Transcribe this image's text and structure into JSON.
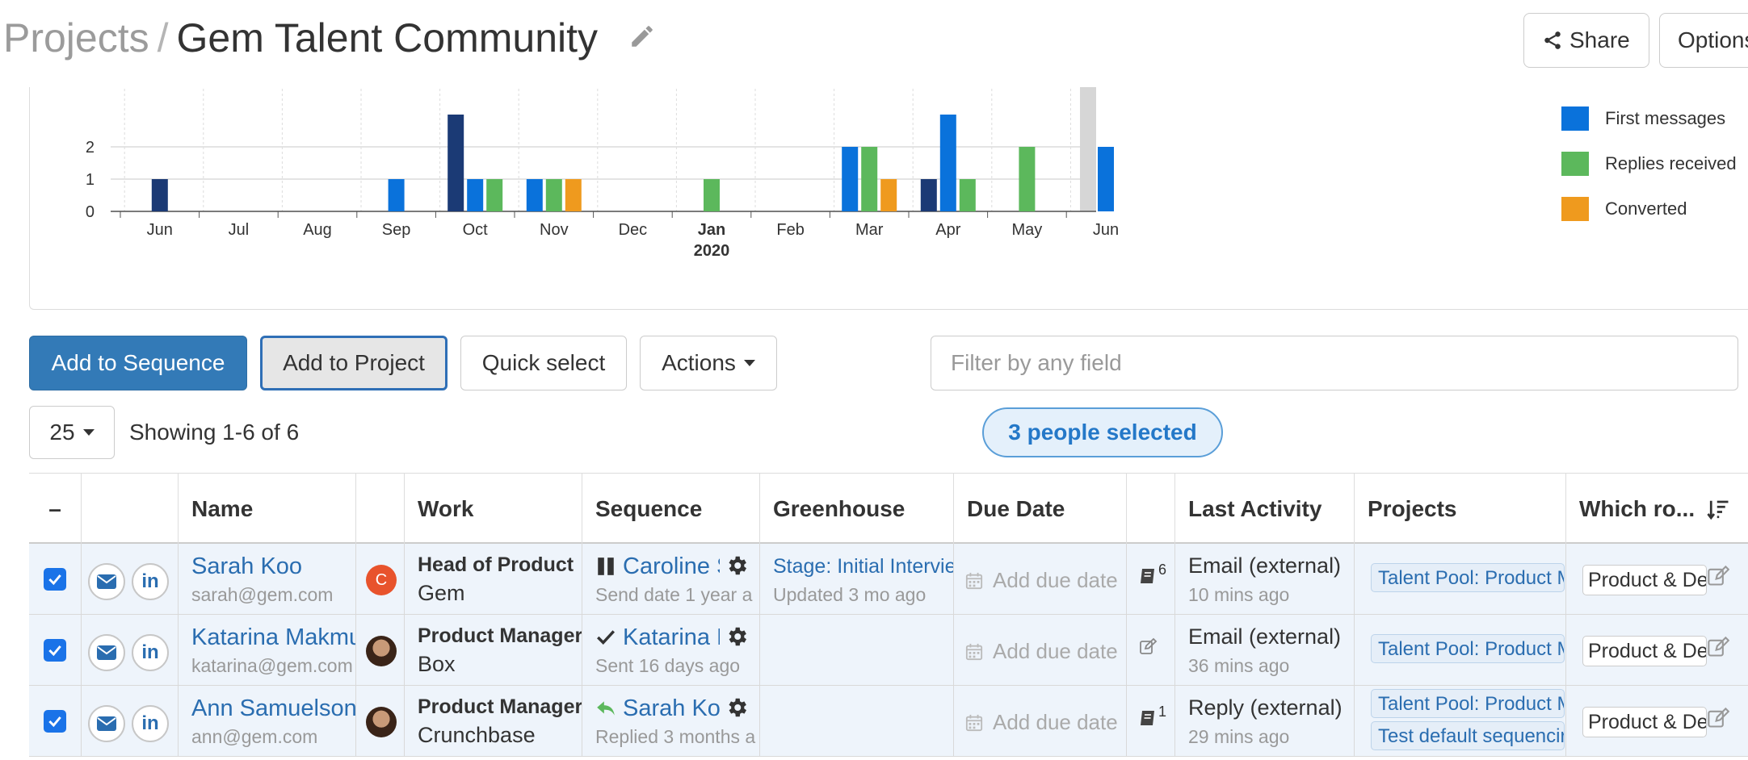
{
  "header": {
    "breadcrumb_root": "Projects",
    "breadcrumb_sep": "/",
    "title": "Gem Talent Community",
    "share_label": "Share",
    "options_label": "Options"
  },
  "chart_data": {
    "type": "bar",
    "categories": [
      "Jun",
      "Jul",
      "Aug",
      "Sep",
      "Oct",
      "Nov",
      "Dec",
      "Jan",
      "Feb",
      "Mar",
      "Apr",
      "May",
      "Jun"
    ],
    "category_sublabels": [
      "",
      "",
      "",
      "",
      "",
      "",
      "",
      "2020",
      "",
      "",
      "",
      "",
      ""
    ],
    "ylim": [
      0,
      2
    ],
    "yticks": [
      0,
      1,
      2
    ],
    "grid": true,
    "legend_position": "right",
    "series": [
      {
        "name": "",
        "color": "#1b3a75",
        "values": [
          1,
          0,
          0,
          0,
          3,
          0,
          0,
          0,
          0,
          0,
          1,
          0,
          0
        ]
      },
      {
        "name": "First messages",
        "color": "#0a72db",
        "values": [
          0,
          0,
          0,
          1,
          1,
          1,
          0,
          0,
          0,
          2,
          3,
          0,
          2
        ]
      },
      {
        "name": "Replies received",
        "color": "#5cb85c",
        "values": [
          0,
          0,
          0,
          0,
          1,
          1,
          0,
          1,
          0,
          2,
          1,
          2,
          0
        ]
      },
      {
        "name": "Converted",
        "color": "#ef9a1e",
        "values": [
          0,
          0,
          0,
          0,
          0,
          1,
          0,
          0,
          0,
          1,
          0,
          0,
          0
        ]
      }
    ]
  },
  "toolbar": {
    "add_to_sequence": "Add to Sequence",
    "add_to_project": "Add to Project",
    "quick_select": "Quick select",
    "actions": "Actions",
    "filter_placeholder": "Filter by any field",
    "per_page": "25",
    "showing": "Showing 1-6 of 6",
    "selected": "3 people selected"
  },
  "table": {
    "headers": {
      "select": "–",
      "name": "Name",
      "work": "Work",
      "sequence": "Sequence",
      "greenhouse": "Greenhouse",
      "due_date": "Due Date",
      "last_activity": "Last Activity",
      "projects": "Projects",
      "which": "Which ro..."
    },
    "rows": [
      {
        "name": "Sarah Koo",
        "email": "sarah@gem.com",
        "avatar_letter": "C",
        "work_title": "Head of Product",
        "work_company": "Gem",
        "sequence_name": "Caroline S",
        "sequence_sub": "Send date 1 year a",
        "sequence_status_icon": "pause-icon",
        "greenhouse_stage": "Stage: Initial Intervie",
        "greenhouse_sub": "Updated 3 mo ago",
        "due": "Add due date",
        "note_count": "6",
        "activity": "Email (external)",
        "activity_time": "10 mins ago",
        "projects": [
          "Talent Pool: Product M"
        ],
        "which": "Product & De"
      },
      {
        "name": "Katarina Makmu",
        "email": "katarina@gem.com",
        "avatar_letter": "",
        "work_title": "Product Manager,",
        "work_company": "Box",
        "sequence_name": "Katarina M",
        "sequence_sub": "Sent 16 days ago",
        "sequence_status_icon": "check-icon",
        "greenhouse_stage": "",
        "greenhouse_sub": "",
        "due": "Add due date",
        "note_count": "",
        "activity": "Email (external)",
        "activity_time": "36 mins ago",
        "projects": [
          "Talent Pool: Product M"
        ],
        "which": "Product & De"
      },
      {
        "name": "Ann Samuelson",
        "email": "ann@gem.com",
        "avatar_letter": "",
        "work_title": "Product Manager",
        "work_company": "Crunchbase",
        "sequence_name": "Sarah Koo",
        "sequence_sub": "Replied 3 months a",
        "sequence_status_icon": "reply-icon",
        "greenhouse_stage": "",
        "greenhouse_sub": "",
        "due": "Add due date",
        "note_count": "1",
        "activity": "Reply (external)",
        "activity_time": "29 mins ago",
        "projects": [
          "Talent Pool: Product M",
          "Test default sequencir"
        ],
        "which": "Product & De"
      }
    ]
  }
}
